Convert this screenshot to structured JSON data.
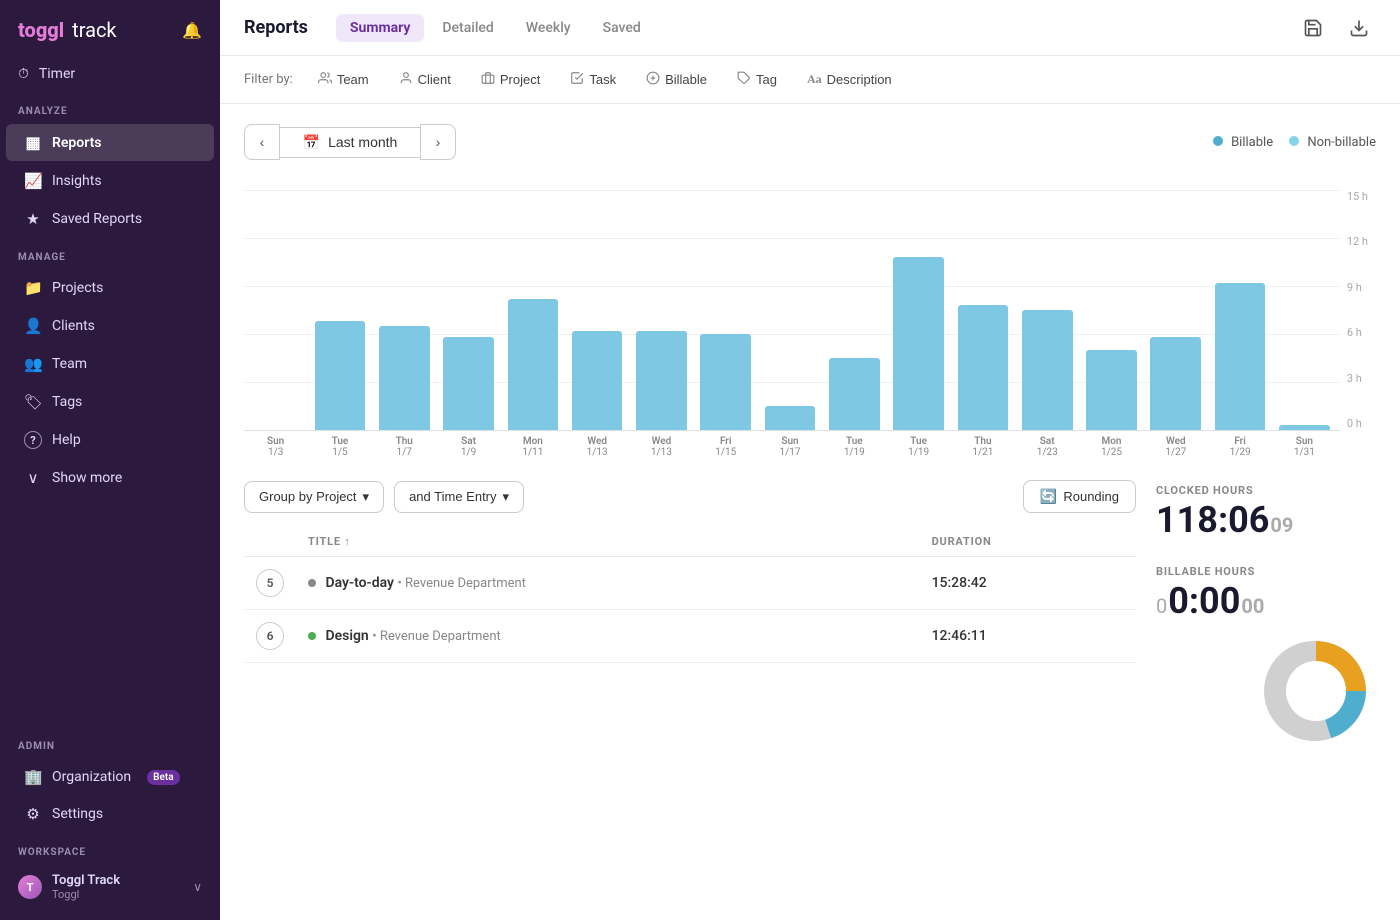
{
  "app": {
    "logo": "toggl",
    "logo_track": "track",
    "page_title": "Reports"
  },
  "sidebar": {
    "bell_label": "🔔",
    "timer_label": "Timer",
    "timer_icon": "⏱",
    "sections": [
      {
        "label": "ANALYZE",
        "items": [
          {
            "id": "reports",
            "icon": "▦",
            "label": "Reports",
            "active": true
          },
          {
            "id": "insights",
            "icon": "📈",
            "label": "Insights",
            "active": false
          },
          {
            "id": "saved-reports",
            "icon": "★",
            "label": "Saved Reports",
            "active": false
          }
        ]
      },
      {
        "label": "MANAGE",
        "items": [
          {
            "id": "projects",
            "icon": "📁",
            "label": "Projects",
            "active": false
          },
          {
            "id": "clients",
            "icon": "👤",
            "label": "Clients",
            "active": false
          },
          {
            "id": "team",
            "icon": "👥",
            "label": "Team",
            "active": false
          },
          {
            "id": "tags",
            "icon": "🏷",
            "label": "Tags",
            "active": false
          },
          {
            "id": "help",
            "icon": "?",
            "label": "Help",
            "active": false
          }
        ]
      }
    ],
    "show_more_label": "Show more",
    "admin_section": "ADMIN",
    "admin_items": [
      {
        "id": "organization",
        "icon": "🏢",
        "label": "Organization",
        "badge": "Beta"
      },
      {
        "id": "settings",
        "icon": "⚙",
        "label": "Settings"
      }
    ],
    "workspace_section": "WORKSPACE",
    "workspace_name": "Toggl Track",
    "workspace_sub": "Toggl"
  },
  "topbar": {
    "title": "Reports",
    "tabs": [
      {
        "id": "summary",
        "label": "Summary",
        "active": true
      },
      {
        "id": "detailed",
        "label": "Detailed",
        "active": false
      },
      {
        "id": "weekly",
        "label": "Weekly",
        "active": false
      },
      {
        "id": "saved",
        "label": "Saved",
        "active": false
      }
    ],
    "save_icon": "💾",
    "download_icon": "⬇"
  },
  "filterbar": {
    "label": "Filter by:",
    "filters": [
      {
        "id": "team",
        "icon": "👥",
        "label": "Team"
      },
      {
        "id": "client",
        "icon": "👤",
        "label": "Client"
      },
      {
        "id": "project",
        "icon": "📁",
        "label": "Project"
      },
      {
        "id": "task",
        "icon": "☑",
        "label": "Task"
      },
      {
        "id": "billable",
        "icon": "💲",
        "label": "Billable"
      },
      {
        "id": "tag",
        "icon": "🏷",
        "label": "Tag"
      },
      {
        "id": "description",
        "icon": "Aa",
        "label": "Description"
      }
    ]
  },
  "daterange": {
    "label": "Last month",
    "calendar_icon": "📅",
    "prev_icon": "‹",
    "next_icon": "›",
    "legend": [
      {
        "id": "billable",
        "label": "Billable",
        "color": "#4faece"
      },
      {
        "id": "non-billable",
        "label": "Non-billable",
        "color": "#85d3e8"
      }
    ]
  },
  "chart": {
    "y_labels": [
      "15 h",
      "12 h",
      "9 h",
      "6 h",
      "3 h",
      "0 h"
    ],
    "max_hours": 15,
    "bars": [
      {
        "day": "Sun",
        "date": "1/3",
        "hours": 0
      },
      {
        "day": "Tue",
        "date": "1/5",
        "hours": 6.8
      },
      {
        "day": "Thu",
        "date": "1/7",
        "hours": 6.5
      },
      {
        "day": "Sat",
        "date": "1/9",
        "hours": 5.8
      },
      {
        "day": "Mon",
        "date": "1/11",
        "hours": 8.2
      },
      {
        "day": "Wed",
        "date": "1/13",
        "hours": 6.2
      },
      {
        "day": "Wed",
        "date": "1/13",
        "hours": 6.2
      },
      {
        "day": "Fri",
        "date": "1/15",
        "hours": 6.0
      },
      {
        "day": "Sun",
        "date": "1/17",
        "hours": 1.5
      },
      {
        "day": "Tue",
        "date": "1/19",
        "hours": 4.5
      },
      {
        "day": "Tue",
        "date": "1/19",
        "hours": 10.8
      },
      {
        "day": "Thu",
        "date": "1/21",
        "hours": 7.8
      },
      {
        "day": "Sat",
        "date": "1/23",
        "hours": 7.5
      },
      {
        "day": "Mon",
        "date": "1/25",
        "hours": 5.0
      },
      {
        "day": "Wed",
        "date": "1/27",
        "hours": 5.8
      },
      {
        "day": "Fri",
        "date": "1/29",
        "hours": 9.2
      },
      {
        "day": "Sun",
        "date": "1/31",
        "hours": 0.3
      }
    ]
  },
  "table": {
    "group_by_label": "Group by Project",
    "time_entry_label": "and Time Entry",
    "rounding_label": "Rounding",
    "columns": [
      {
        "id": "toggle",
        "label": ""
      },
      {
        "id": "title",
        "label": "TITLE",
        "sort": "asc"
      },
      {
        "id": "duration",
        "label": "DURATION"
      }
    ],
    "rows": [
      {
        "count": "5",
        "project": "Day-to-day",
        "project_color": "#888",
        "client": "Revenue Department",
        "duration": "15:28:42"
      },
      {
        "count": "6",
        "project": "Design",
        "project_color": "#4caf50",
        "client": "Revenue Department",
        "duration": "12:46:11"
      }
    ]
  },
  "stats": {
    "clocked_label": "CLOCKED HOURS",
    "clocked_value": "118:06",
    "clocked_seconds": "09",
    "billable_label": "BILLABLE HOURS",
    "billable_value": "0:00",
    "billable_seconds": "00",
    "billable_prefix": "0"
  }
}
